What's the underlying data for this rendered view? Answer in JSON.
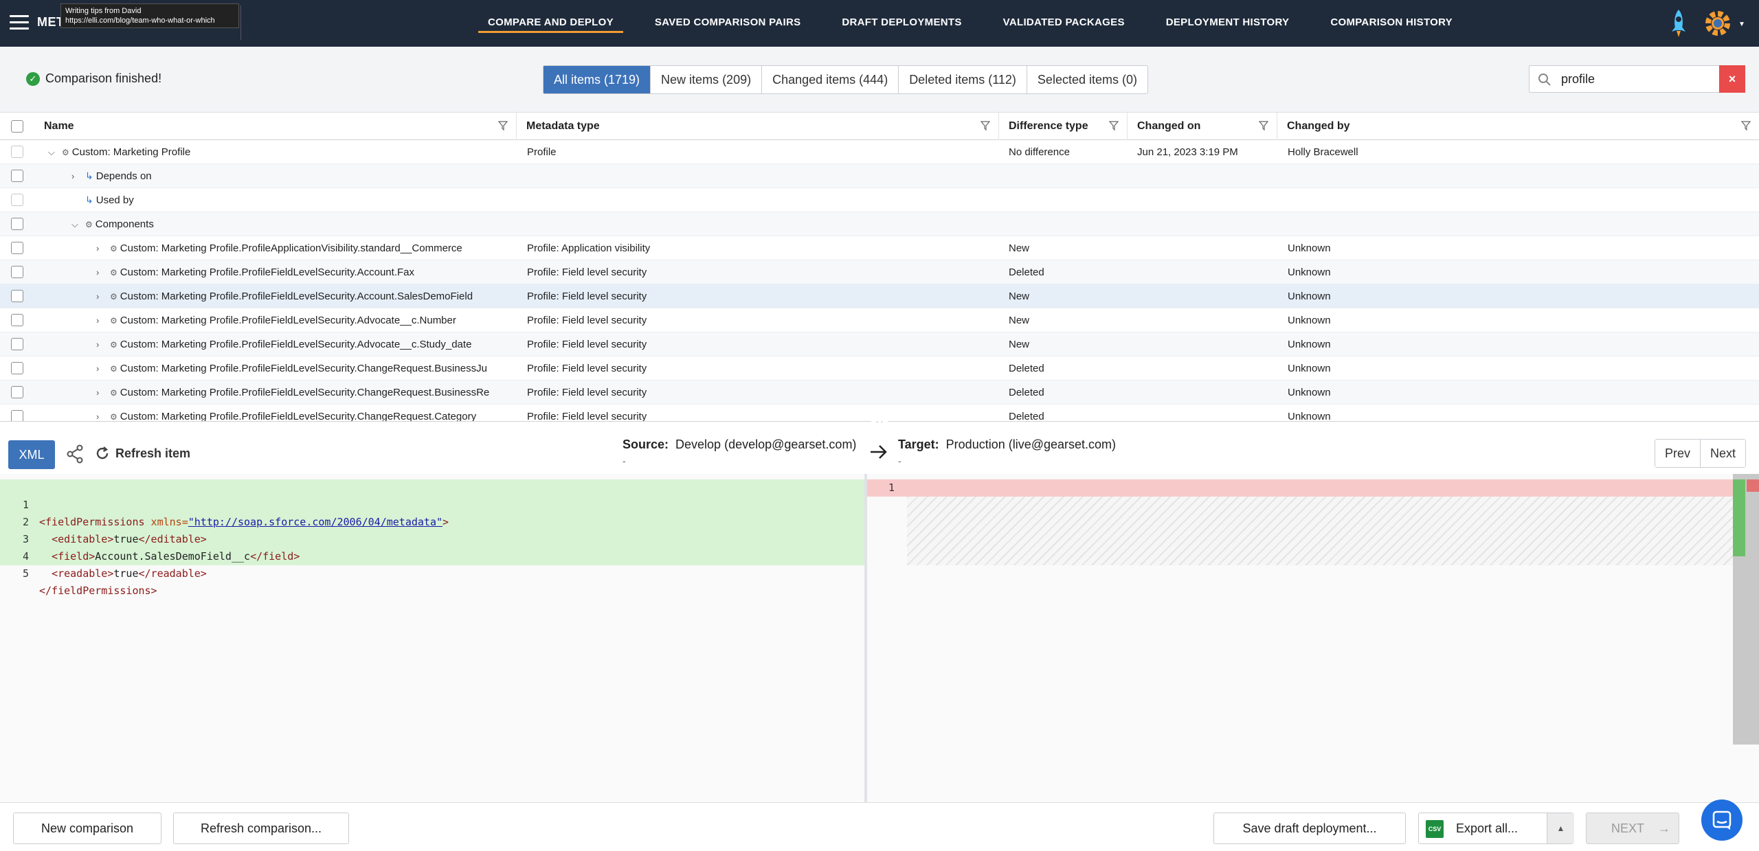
{
  "app": {
    "brand": "MET"
  },
  "tooltip": {
    "line1": "Writing tips from David",
    "line2": "https://elli.com/blog/team-who-what-or-which"
  },
  "nav": {
    "items": [
      {
        "label": "COMPARE AND DEPLOY",
        "active": true
      },
      {
        "label": "SAVED COMPARISON PAIRS"
      },
      {
        "label": "DRAFT DEPLOYMENTS"
      },
      {
        "label": "VALIDATED PACKAGES"
      },
      {
        "label": "DEPLOYMENT HISTORY"
      },
      {
        "label": "COMPARISON HISTORY"
      }
    ]
  },
  "status": {
    "message": "Comparison finished!"
  },
  "filters": [
    {
      "label": "All items (1719)",
      "active": true
    },
    {
      "label": "New items (209)"
    },
    {
      "label": "Changed items (444)"
    },
    {
      "label": "Deleted items (112)"
    },
    {
      "label": "Selected items (0)"
    }
  ],
  "search": {
    "value": "profile",
    "clear": "×"
  },
  "table": {
    "columns": [
      "Name",
      "Metadata type",
      "Difference type",
      "Changed on",
      "Changed by"
    ],
    "rows": [
      {
        "name": "Custom: Marketing Profile",
        "type": "Profile",
        "diff": "No difference",
        "changed_on": "Jun 21, 2023 3:19 PM",
        "changed_by": "Holly Bracewell"
      },
      {
        "name": "Depends on",
        "type": "",
        "diff": "",
        "changed_on": "",
        "changed_by": ""
      },
      {
        "name": "Used by",
        "type": "",
        "diff": "",
        "changed_on": "",
        "changed_by": ""
      },
      {
        "name": "Components",
        "type": "",
        "diff": "",
        "changed_on": "",
        "changed_by": ""
      },
      {
        "name": "Custom: Marketing Profile.ProfileApplicationVisibility.standard__Commerce",
        "type": "Profile: Application visibility",
        "diff": "New",
        "changed_on": "",
        "changed_by": "Unknown"
      },
      {
        "name": "Custom: Marketing Profile.ProfileFieldLevelSecurity.Account.Fax",
        "type": "Profile: Field level security",
        "diff": "Deleted",
        "changed_on": "",
        "changed_by": "Unknown"
      },
      {
        "name": "Custom: Marketing Profile.ProfileFieldLevelSecurity.Account.SalesDemoField",
        "type": "Profile: Field level security",
        "diff": "New",
        "changed_on": "",
        "changed_by": "Unknown"
      },
      {
        "name": "Custom: Marketing Profile.ProfileFieldLevelSecurity.Advocate__c.Number",
        "type": "Profile: Field level security",
        "diff": "New",
        "changed_on": "",
        "changed_by": "Unknown"
      },
      {
        "name": "Custom: Marketing Profile.ProfileFieldLevelSecurity.Advocate__c.Study_date",
        "type": "Profile: Field level security",
        "diff": "New",
        "changed_on": "",
        "changed_by": "Unknown"
      },
      {
        "name": "Custom: Marketing Profile.ProfileFieldLevelSecurity.ChangeRequest.BusinessJu",
        "type": "Profile: Field level security",
        "diff": "Deleted",
        "changed_on": "",
        "changed_by": "Unknown"
      },
      {
        "name": "Custom: Marketing Profile.ProfileFieldLevelSecurity.ChangeRequest.BusinessRe",
        "type": "Profile: Field level security",
        "diff": "Deleted",
        "changed_on": "",
        "changed_by": "Unknown"
      },
      {
        "name": "Custom: Marketing Profile.ProfileFieldLevelSecurity.ChangeRequest.Category",
        "type": "Profile: Field level security",
        "diff": "Deleted",
        "changed_on": "",
        "changed_by": "Unknown"
      }
    ]
  },
  "diff": {
    "format_label": "XML",
    "refresh_label": "Refresh item",
    "source_label": "Source:",
    "source_value": "Develop (develop@gearset.com)",
    "source_sub": "-",
    "target_label": "Target:",
    "target_value": "Production (live@gearset.com)",
    "target_sub": "-",
    "prev": "Prev",
    "next": "Next",
    "left_lines": [
      {
        "n": "1",
        "indent": "",
        "open": "<fieldPermissions",
        "attr": " xmlns=",
        "str": "\"http://soap.sforce.com/2006/04/metadata\"",
        "close": ">"
      },
      {
        "n": "2",
        "indent": "  ",
        "open": "<editable>",
        "text": "true",
        "end": "</editable>"
      },
      {
        "n": "3",
        "indent": "  ",
        "open": "<field>",
        "text": "Account.SalesDemoField__c",
        "end": "</field>"
      },
      {
        "n": "4",
        "indent": "  ",
        "open": "<readable>",
        "text": "true",
        "end": "</readable>"
      },
      {
        "n": "5",
        "indent": "",
        "open": "</fieldPermissions>",
        "text": "",
        "end": ""
      }
    ],
    "right_line_number": "1"
  },
  "footer": {
    "new_comparison": "New comparison",
    "refresh_comparison": "Refresh comparison...",
    "save_draft": "Save draft deployment...",
    "csv_badge": "CSV",
    "export_all": "Export all...",
    "next": "NEXT"
  },
  "colors": {
    "nav_bg": "#1f2b3b",
    "accent": "#3d73b9",
    "active_underline": "#f39c32",
    "added": "#d7f3d4",
    "removed": "#f8c9c9"
  }
}
